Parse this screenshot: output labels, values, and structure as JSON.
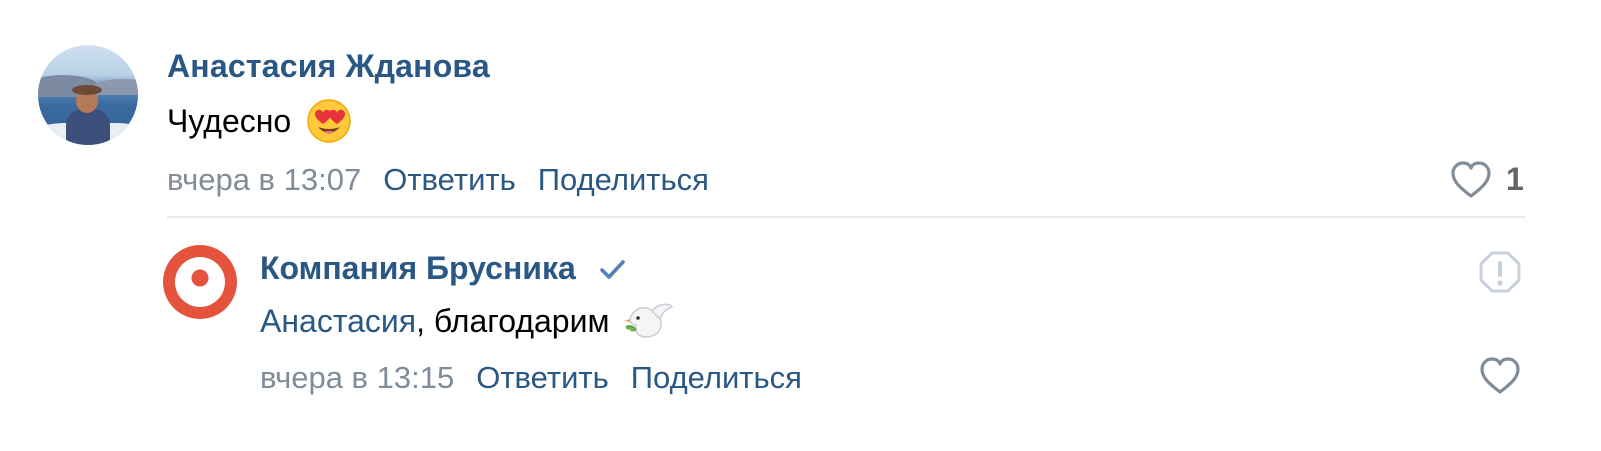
{
  "comment": {
    "author": "Анастасия Жданова",
    "text": "Чудесно",
    "emoji": "heart-eyes",
    "time": "вчера в 13:07",
    "reply_label": "Ответить",
    "share_label": "Поделиться",
    "likes": "1"
  },
  "reply": {
    "author": "Компания Брусника",
    "verified": true,
    "mention": "Анастасия",
    "text": ", благодарим",
    "emoji": "dove",
    "time": "вчера в 13:15",
    "reply_label": "Ответить",
    "share_label": "Поделиться"
  },
  "colors": {
    "link": "#2a5885",
    "meta": "#818c99",
    "brand": "#e5533d",
    "verified": "#5181b8"
  }
}
